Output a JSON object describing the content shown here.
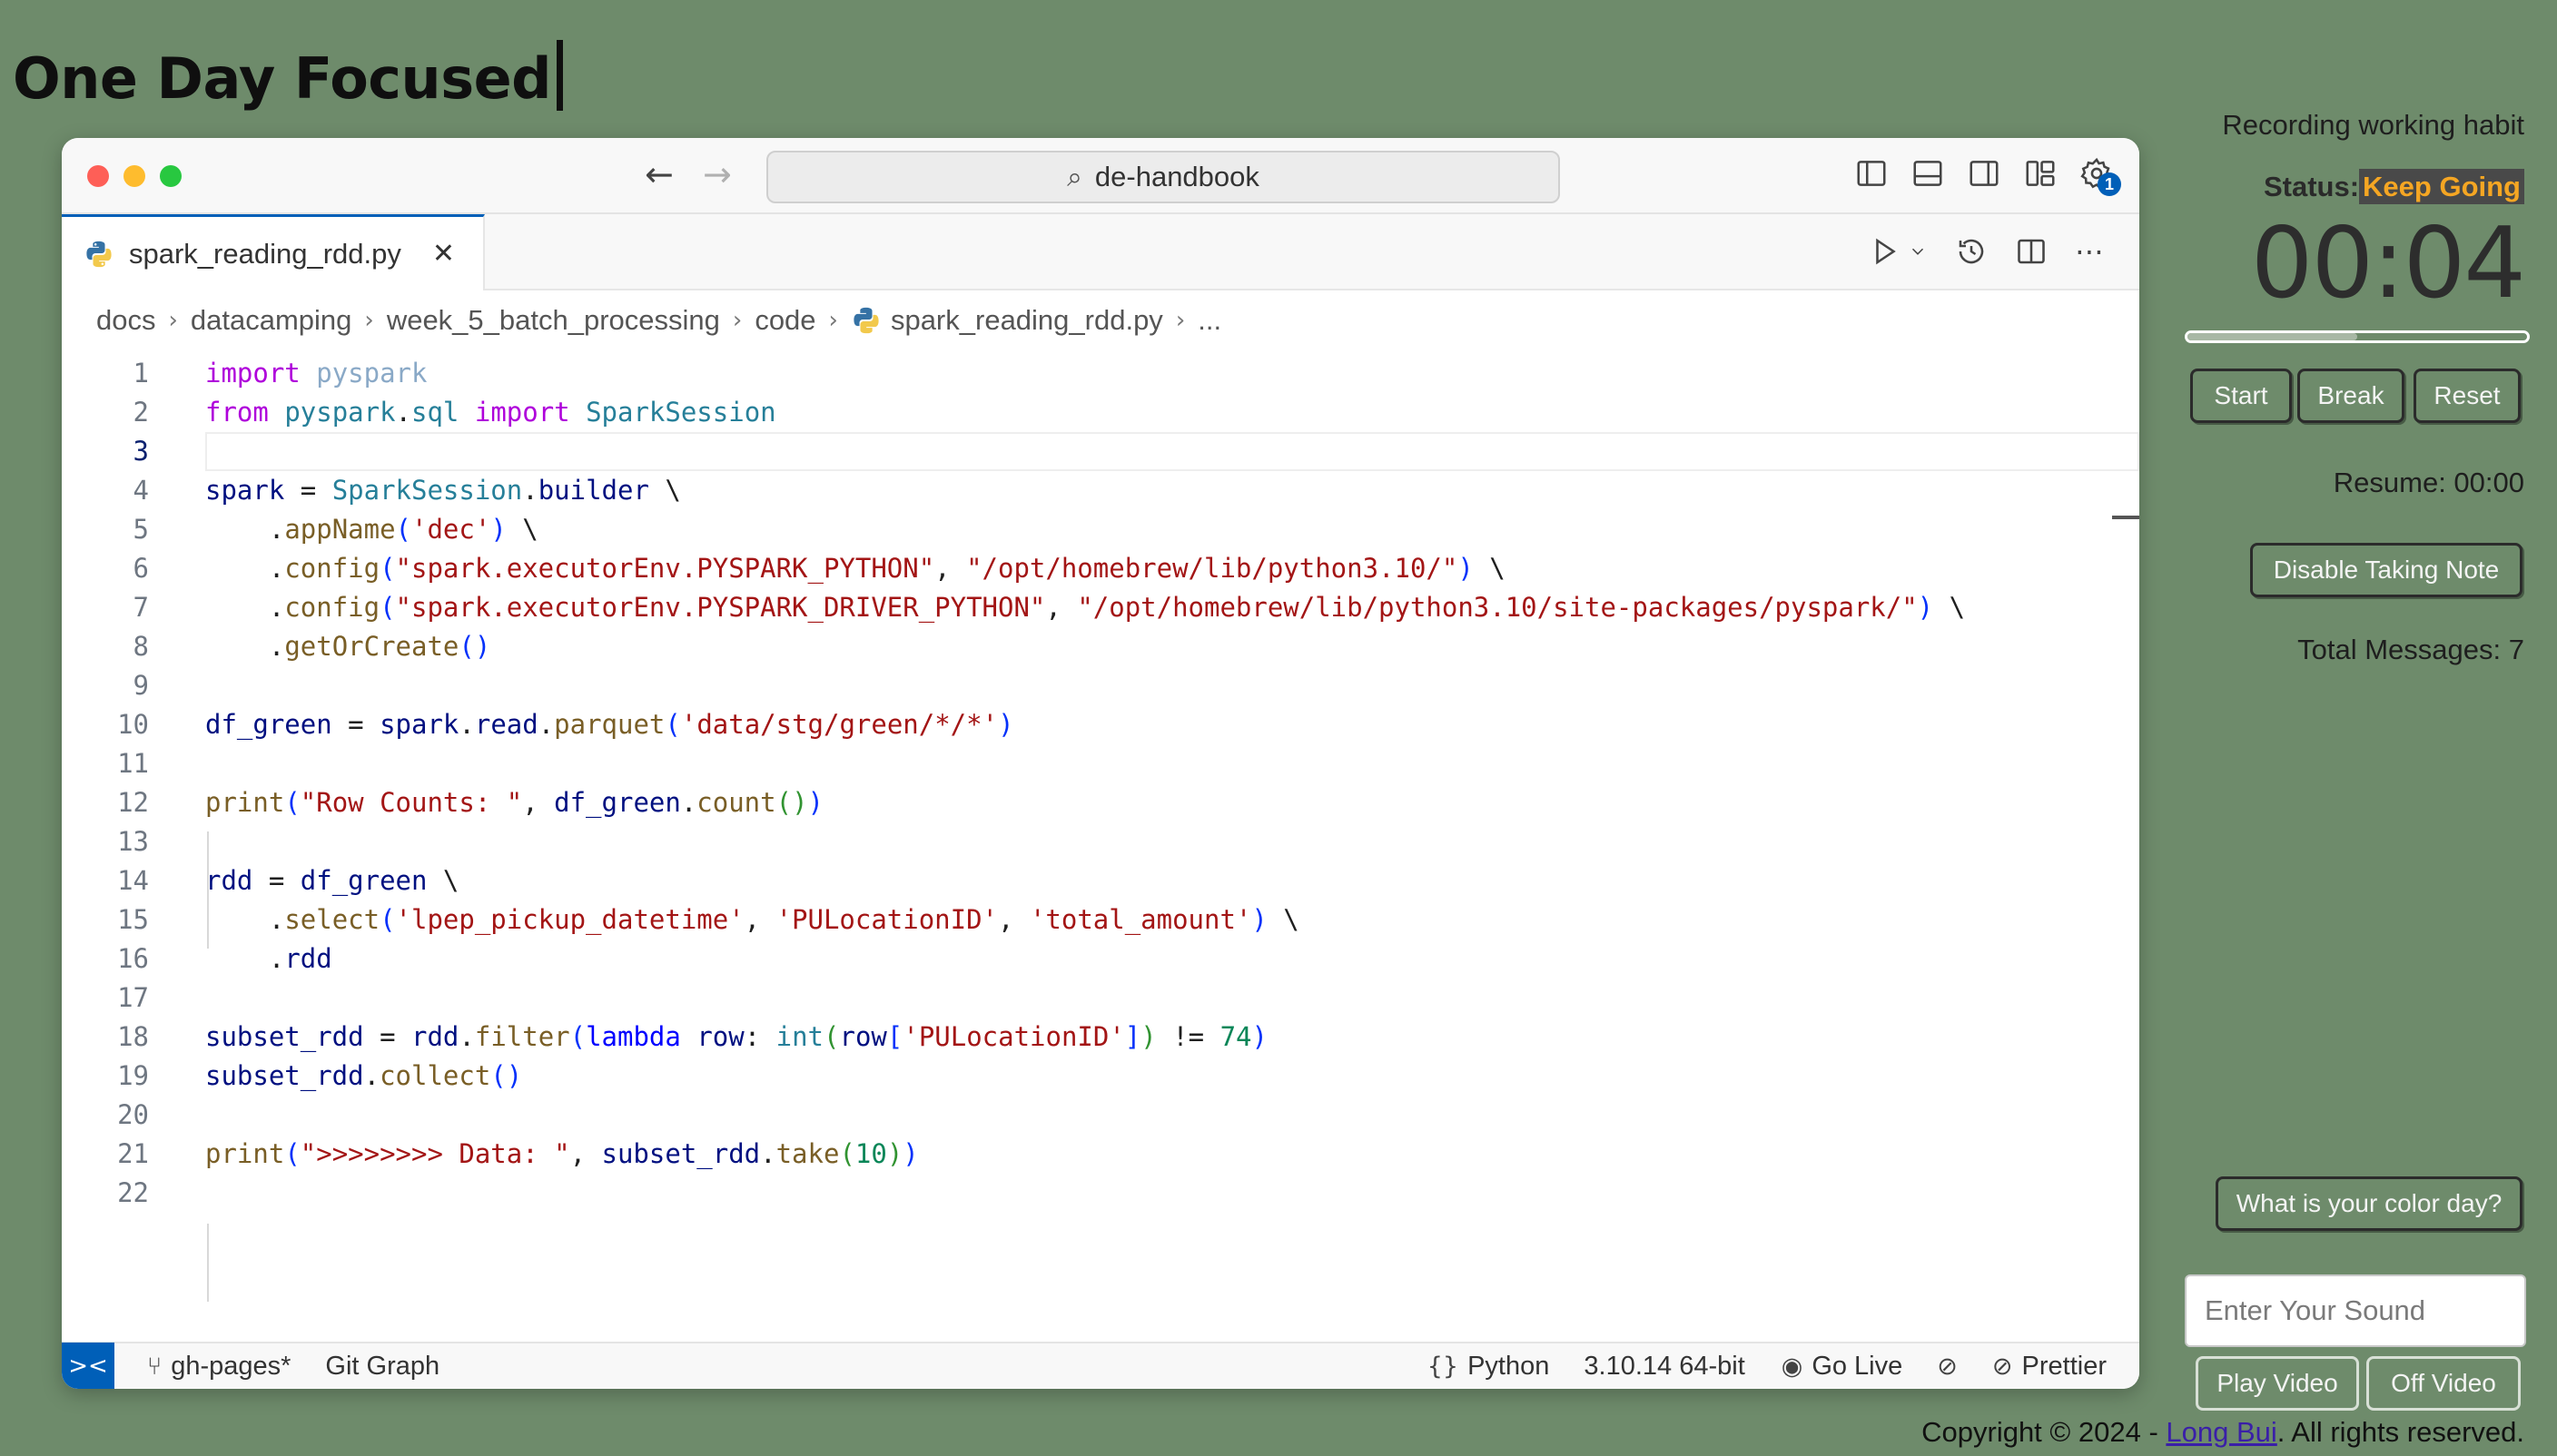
{
  "page_title": "One Day Focused",
  "window": {
    "search_text": "de-handbook"
  },
  "tab": {
    "filename": "spark_reading_rdd.py"
  },
  "breadcrumb": {
    "items": [
      "docs",
      "datacamping",
      "week_5_batch_processing",
      "code",
      "spark_reading_rdd.py",
      "..."
    ]
  },
  "code": {
    "line_numbers": [
      "1",
      "2",
      "3",
      "4",
      "5",
      "6",
      "7",
      "8",
      "9",
      "10",
      "11",
      "12",
      "13",
      "14",
      "15",
      "16",
      "17",
      "18",
      "19",
      "20",
      "21",
      "22"
    ],
    "active_line": "3"
  },
  "statusbar": {
    "branch": "gh-pages*",
    "git_graph": "Git Graph",
    "language": "Python",
    "interpreter": "3.10.14 64-bit",
    "go_live": "Go Live",
    "prettier": "Prettier"
  },
  "panel": {
    "caption": "Recording working habit",
    "status_label": "Status:",
    "status_value": "Keep Going",
    "timer": "00:04",
    "progress_fraction": 0.5,
    "start_label": "Start",
    "break_label": "Break",
    "reset_label": "Reset",
    "resume": "Resume: 00:00",
    "disable_note_label": "Disable Taking Note",
    "total_messages": "Total Messages: 7",
    "color_day_label": "What is your color day?",
    "sound_placeholder": "Enter Your Sound",
    "play_video_label": "Play Video",
    "off_video_label": "Off Video"
  },
  "footer": {
    "prefix": "Copyright © 2024 - ",
    "author": "Long Bui",
    "suffix": ". All rights reserved."
  },
  "colors": {
    "background": "#6e8b6b",
    "accent": "#005fb8",
    "status_highlight": "#f5a623"
  }
}
